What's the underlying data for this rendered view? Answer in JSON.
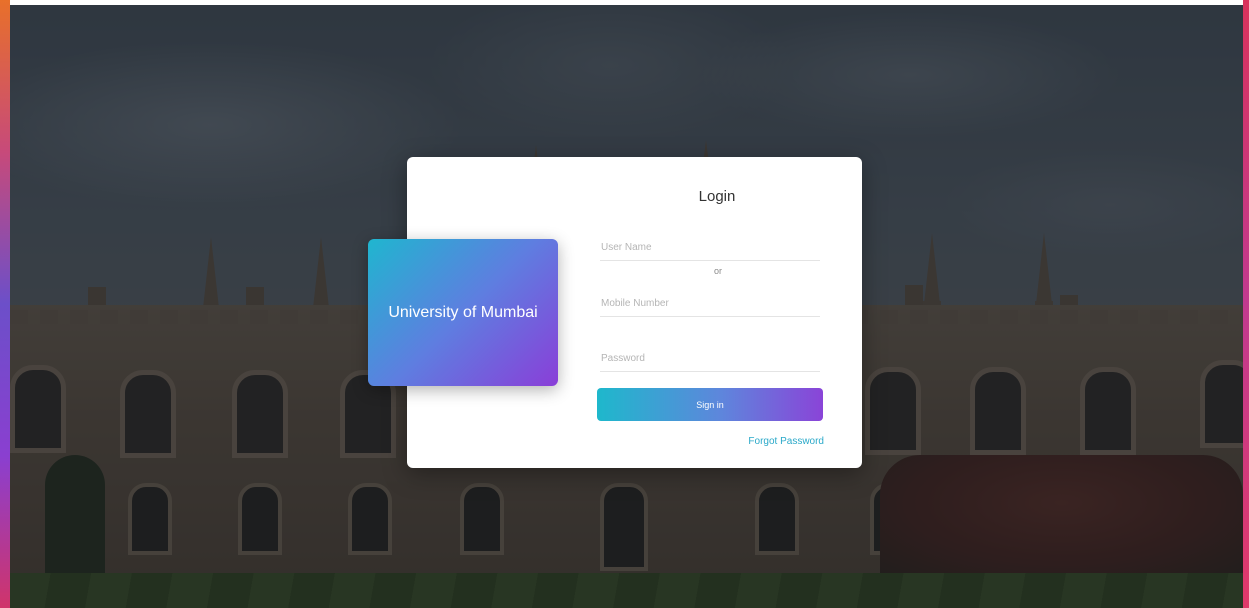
{
  "login": {
    "title": "Login",
    "brand_name": "University of Mumbai",
    "username_placeholder": "User Name",
    "username_value": "",
    "or_label": "or",
    "mobile_placeholder": "Mobile Number",
    "mobile_value": "",
    "password_placeholder": "Password",
    "password_value": "",
    "signin_label": "Sign in",
    "forgot_label": "Forgot Password"
  },
  "colors": {
    "accent_start": "#1fb6cf",
    "accent_end": "#8a3ed8",
    "link": "#2aa9c9"
  }
}
